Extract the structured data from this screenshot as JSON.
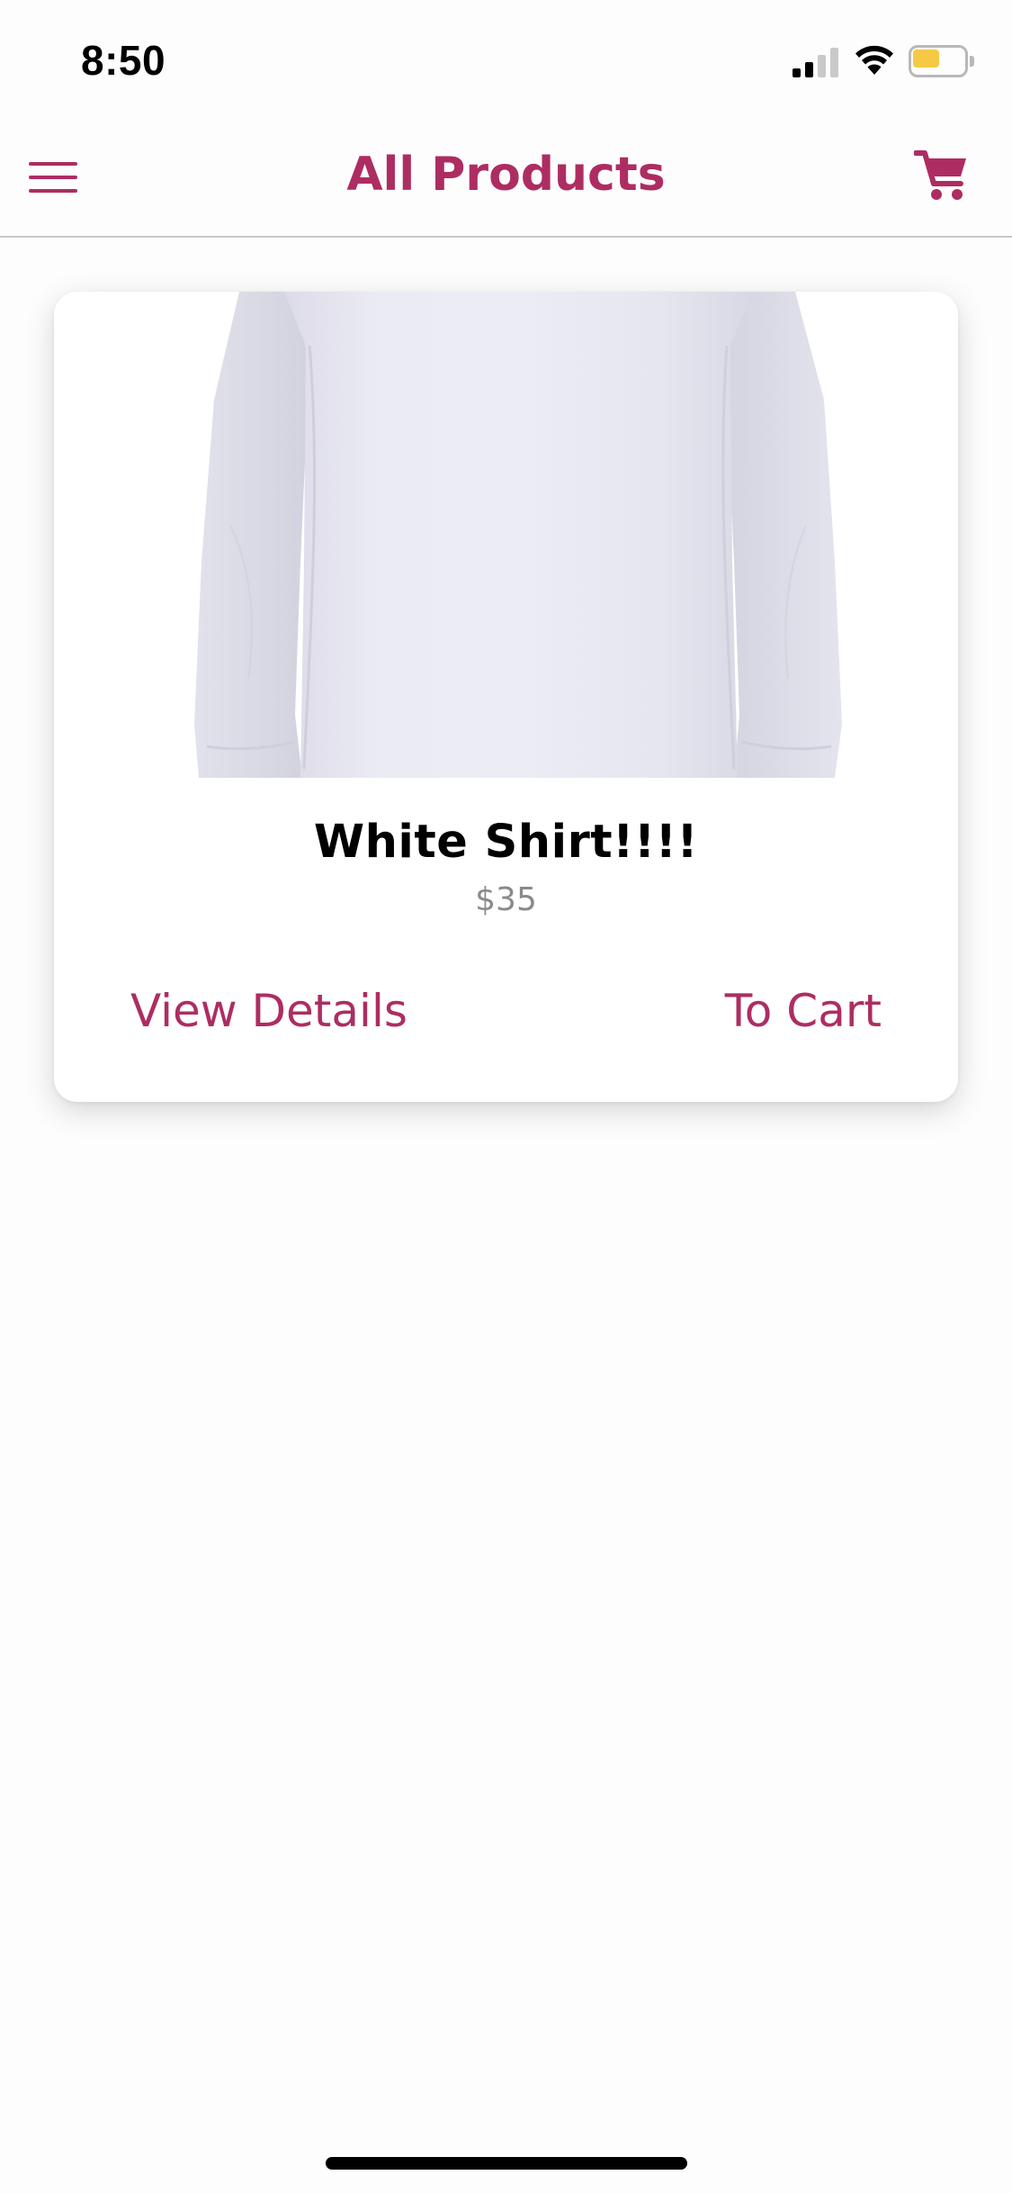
{
  "status_bar": {
    "time": "8:50",
    "signal_icon": "cellular-signal-icon",
    "wifi_icon": "wifi-icon",
    "battery_icon": "battery-icon",
    "battery_color": "#f5c945"
  },
  "header": {
    "title": "All Products",
    "menu_icon": "hamburger-menu-icon",
    "cart_icon": "shopping-cart-icon",
    "accent_color": "#ad2d62"
  },
  "products": [
    {
      "image_icon": "white-shirt-image",
      "name": "White Shirt!!!!",
      "price": "$35",
      "actions": {
        "view_details": "View Details",
        "to_cart": "To Cart"
      }
    }
  ]
}
